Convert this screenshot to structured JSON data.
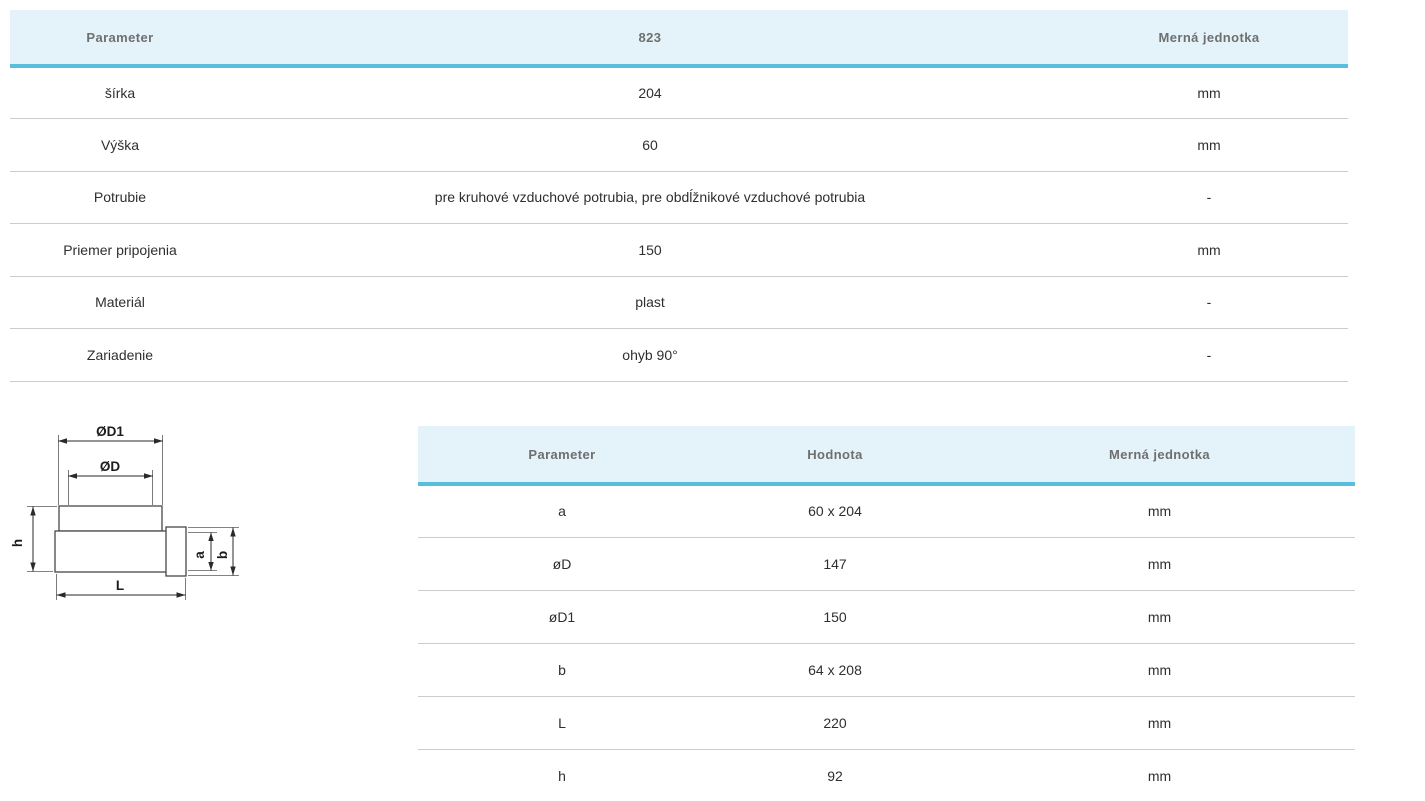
{
  "colors": {
    "header_background": "#e4f3fa",
    "header_accent_border": "#57bedd",
    "row_divider": "#cccccc",
    "header_text": "#6f6f6f",
    "body_text": "#2f2f2f"
  },
  "spec_table": {
    "columns": [
      "Parameter",
      "823",
      "Merná jednotka"
    ],
    "rows": [
      [
        "šírka",
        "204",
        "mm"
      ],
      [
        "Výška",
        "60",
        "mm"
      ],
      [
        "Potrubie",
        "pre kruhové vzduchové potrubia, pre obdĺžnikové vzduchové potrubia",
        "-"
      ],
      [
        "Priemer pripojenia",
        "150",
        "mm"
      ],
      [
        "Materiál",
        "plast",
        "-"
      ],
      [
        "Zariadenie",
        "ohyb 90°",
        "-"
      ]
    ]
  },
  "dimensions_table": {
    "columns": [
      "Parameter",
      "Hodnota",
      "Merná jednotka"
    ],
    "rows": [
      [
        "a",
        "60 x 204",
        "mm"
      ],
      [
        "øD",
        "147",
        "mm"
      ],
      [
        "øD1",
        "150",
        "mm"
      ],
      [
        "b",
        "64 x 208",
        "mm"
      ],
      [
        "L",
        "220",
        "mm"
      ],
      [
        "h",
        "92",
        "mm"
      ]
    ]
  },
  "diagram": {
    "labels": {
      "d1": "ØD1",
      "d": "ØD",
      "h": "h",
      "a": "a",
      "b": "b",
      "l": "L"
    }
  }
}
